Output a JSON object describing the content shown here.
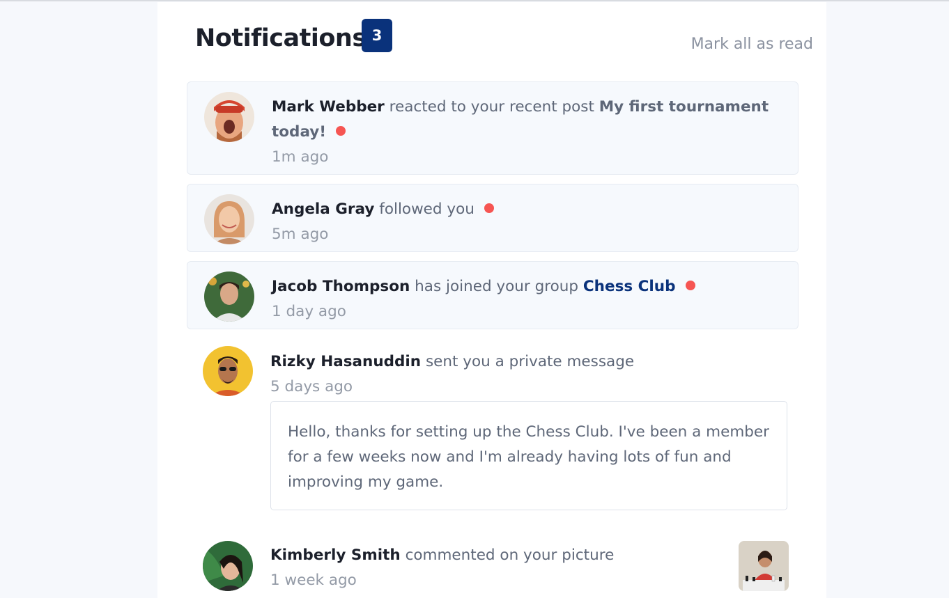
{
  "header": {
    "title": "Notifications",
    "unread_count": "3",
    "mark_all_label": "Mark all as read"
  },
  "notifications": [
    {
      "name": "Mark Webber",
      "action": "reacted to your recent post",
      "target": "My first tournament today!",
      "time": "1m ago",
      "unread": true,
      "avatar": "avatar-mark-webber"
    },
    {
      "name": "Angela Gray",
      "action": "followed you",
      "time": "5m ago",
      "unread": true,
      "avatar": "avatar-angela-gray"
    },
    {
      "name": "Jacob Thompson",
      "action": "has joined your group",
      "target": "Chess Club",
      "time": "1 day ago",
      "unread": true,
      "avatar": "avatar-jacob-thompson"
    },
    {
      "name": "Rizky Hasanuddin",
      "action": "sent you a private message",
      "time": "5 days ago",
      "unread": false,
      "message": "Hello, thanks for setting up the Chess Club. I've been a member for a few weeks now and I'm already having lots of fun and improving my game.",
      "avatar": "avatar-rizky-hasanuddin"
    },
    {
      "name": "Kimberly Smith",
      "action": "commented on your picture",
      "time": "1 week ago",
      "unread": false,
      "avatar": "avatar-kimberly-smith",
      "picture": "chess-picture-thumbnail"
    }
  ],
  "colors": {
    "accent": "#0a327b",
    "unread_dot": "#f65552",
    "unread_bg": "#f6f9fd",
    "page_bg": "#f6f8fc"
  }
}
